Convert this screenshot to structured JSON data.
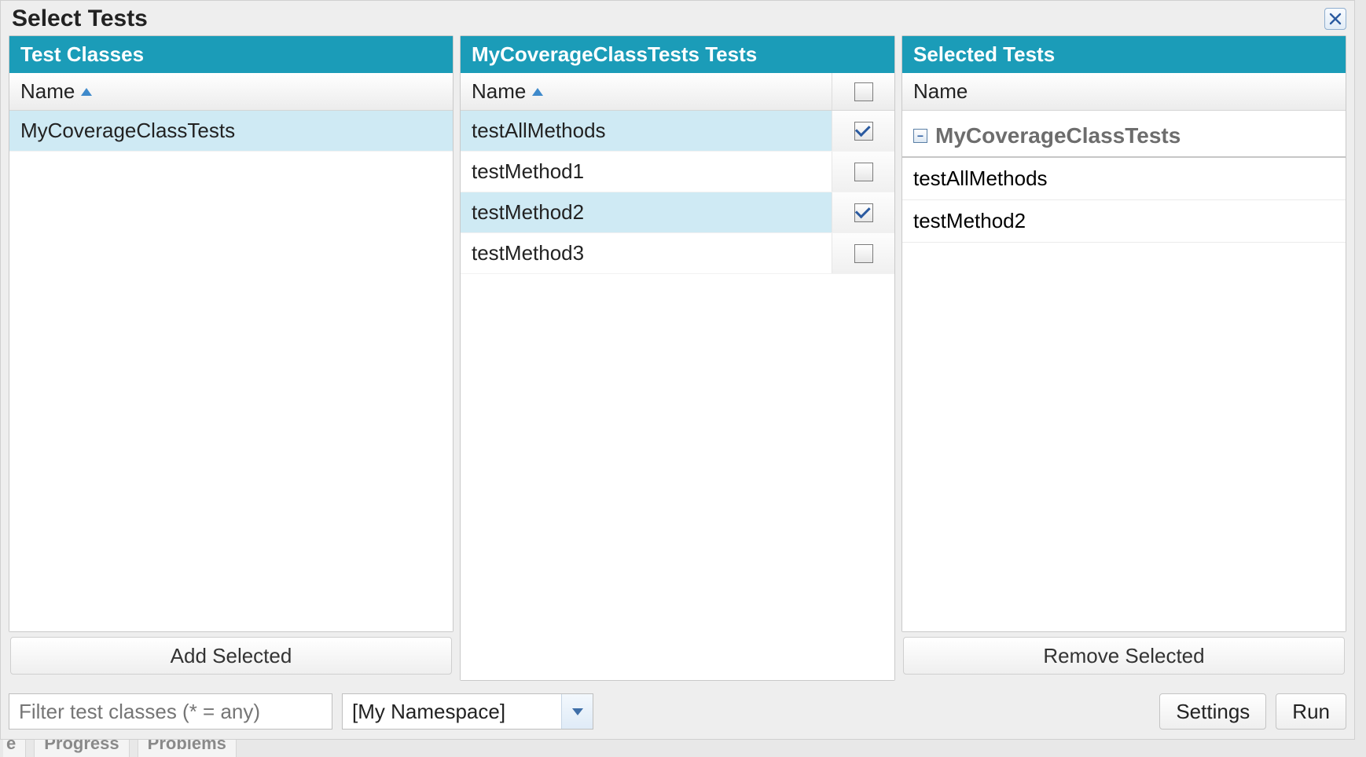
{
  "dialog": {
    "title": "Select Tests"
  },
  "leftPanel": {
    "header": "Test Classes",
    "column": "Name",
    "rows": [
      {
        "name": "MyCoverageClassTests",
        "selected": true
      }
    ],
    "button": "Add Selected"
  },
  "midPanel": {
    "header": "MyCoverageClassTests Tests",
    "column": "Name",
    "headerChecked": false,
    "rows": [
      {
        "name": "testAllMethods",
        "checked": true,
        "selected": true
      },
      {
        "name": "testMethod1",
        "checked": false,
        "selected": false
      },
      {
        "name": "testMethod2",
        "checked": true,
        "selected": true
      },
      {
        "name": "testMethod3",
        "checked": false,
        "selected": false
      }
    ]
  },
  "rightPanel": {
    "header": "Selected Tests",
    "column": "Name",
    "group": "MyCoverageClassTests",
    "items": [
      "testAllMethods",
      "testMethod2"
    ],
    "button": "Remove Selected"
  },
  "bottomBar": {
    "filterPlaceholder": "Filter test classes (* = any)",
    "namespace": "[My Namespace]",
    "settings": "Settings",
    "run": "Run"
  },
  "bgTabs": {
    "left": "e",
    "progress": "Progress",
    "problems": "Problems"
  }
}
